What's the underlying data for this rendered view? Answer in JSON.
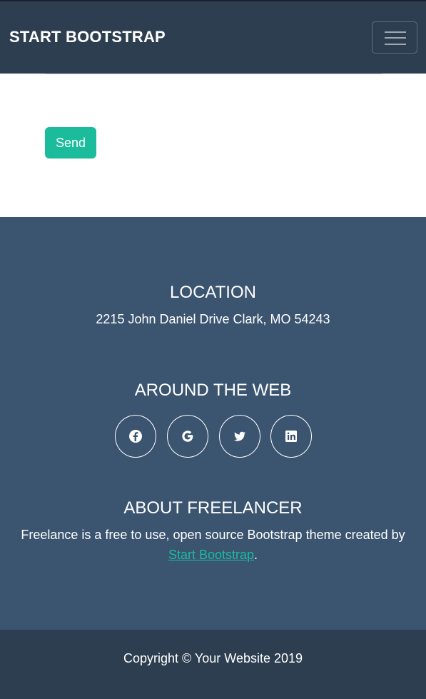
{
  "navbar": {
    "brand": "START BOOTSTRAP",
    "menu_icon": "hamburger-menu-icon"
  },
  "contact_form": {
    "send_label": "Send"
  },
  "footer": {
    "location_title": "LOCATION",
    "location_text": "2215 John Daniel Drive Clark, MO 54243",
    "web_title": "AROUND THE WEB",
    "socials": [
      "facebook-icon",
      "google-icon",
      "twitter-icon",
      "linkedin-icon"
    ],
    "about_title": "ABOUT FREELANCER",
    "about_text": "Freelance is a free to use, open source Bootstrap theme created by",
    "about_link": "Start Bootstrap",
    "about_end": "."
  },
  "copyright": {
    "text": "Copyright © Your Website 2019"
  },
  "colors": {
    "navbar_bg": "#2c3e50",
    "footer_bg": "#3b5570",
    "accent": "#1abc9c"
  }
}
